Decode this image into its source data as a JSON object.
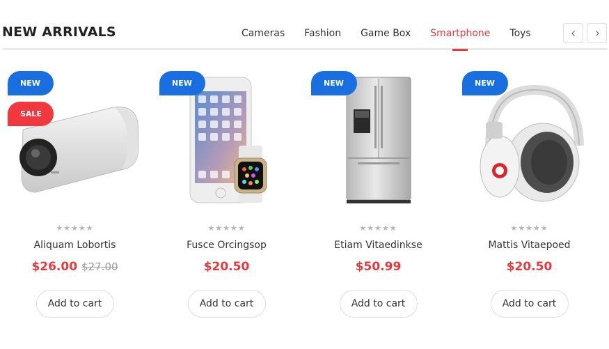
{
  "section": {
    "title": "NEW ARRIVALS",
    "tabs": [
      "Cameras",
      "Fashion",
      "Game Box",
      "Smartphone",
      "Toys"
    ],
    "active_tab": "Smartphone"
  },
  "colors": {
    "accent_red": "#e8393e",
    "badge_new": "#1a6fe0",
    "badge_sale": "#f2383f"
  },
  "products": [
    {
      "name": "Aliquam Lobortis",
      "price": "$26.00",
      "old_price": "$27.00",
      "badges": [
        "NEW",
        "SALE"
      ],
      "stars": "★★★★★",
      "rating": 0,
      "cart_label": "Add to cart",
      "image": "action-camera"
    },
    {
      "name": "Fusce Orcingsop",
      "price": "$20.50",
      "badges": [
        "NEW"
      ],
      "stars": "★★★★★",
      "rating": 0,
      "cart_label": "Add to cart",
      "image": "phone-and-watch"
    },
    {
      "name": "Etiam Vitaedinkse",
      "price": "$50.99",
      "badges": [
        "NEW"
      ],
      "stars": "★★★★★",
      "rating": 0,
      "cart_label": "Add to cart",
      "image": "refrigerator"
    },
    {
      "name": "Mattis Vitaepoed",
      "price": "$20.50",
      "badges": [
        "NEW"
      ],
      "stars": "★★★★★",
      "rating": 0,
      "cart_label": "Add to cart",
      "image": "headphones"
    }
  ],
  "icons": {
    "prev": "chevron-left-icon",
    "next": "chevron-right-icon"
  }
}
